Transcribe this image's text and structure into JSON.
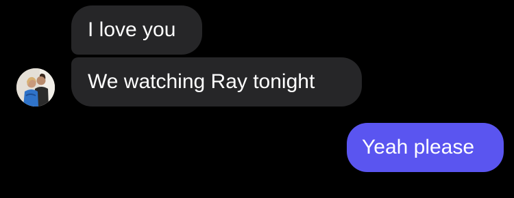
{
  "conversation": {
    "incoming": [
      {
        "text": "I love you"
      },
      {
        "text": "We watching Ray tonight"
      }
    ],
    "outgoing": [
      {
        "text": "Yeah please"
      }
    ]
  },
  "avatar": {
    "icon": "contact-photo"
  },
  "colors": {
    "background": "#000000",
    "incoming_bubble": "#262628",
    "outgoing_bubble": "#5a55f0",
    "text": "#ffffff"
  }
}
